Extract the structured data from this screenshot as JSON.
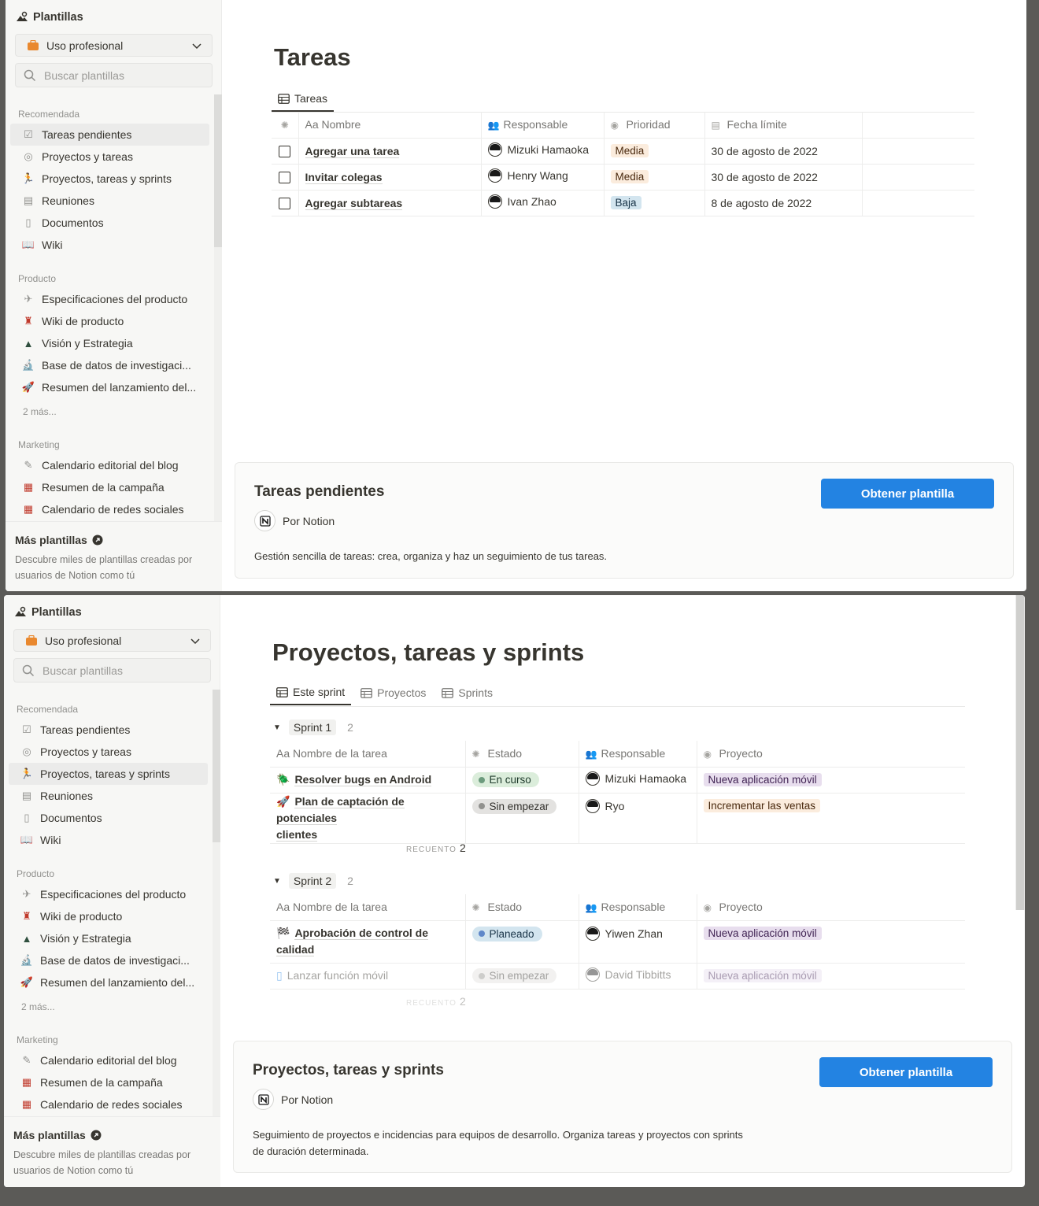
{
  "sidebar": {
    "header": "Plantillas",
    "use_select": "Uso profesional",
    "search_placeholder": "Buscar plantillas",
    "section_recommended": "Recomendada",
    "recommended": [
      "Tareas pendientes",
      "Proyectos y tareas",
      "Proyectos, tareas y sprints",
      "Reuniones",
      "Documentos",
      "Wiki"
    ],
    "section_product": "Producto",
    "product": [
      "Especificaciones del producto",
      "Wiki de producto",
      "Visión y Estrategia",
      "Base de datos de investigaci...",
      "Resumen del lanzamiento del..."
    ],
    "more": "2 más...",
    "section_marketing": "Marketing",
    "marketing": [
      "Calendario editorial del blog",
      "Resumen de la campaña",
      "Calendario de redes sociales"
    ],
    "footer_title": "Más plantillas",
    "footer_desc": "Descubre miles de plantillas creadas por usuarios de Notion como tú"
  },
  "panel1": {
    "title": "Tareas",
    "tab": "Tareas",
    "columns": [
      "Aa Nombre",
      "Responsable",
      "Prioridad",
      "Fecha límite"
    ],
    "rows": [
      {
        "name": "Agregar una tarea",
        "person": "Mizuki Hamaoka",
        "priority": "Media",
        "date": "30 de agosto de 2022"
      },
      {
        "name": "Invitar colegas",
        "person": "Henry Wang",
        "priority": "Media",
        "date": "30 de agosto de 2022"
      },
      {
        "name": "Agregar subtareas",
        "person": "Ivan Zhao",
        "priority": "Baja",
        "date": "8 de agosto de 2022"
      }
    ],
    "card": {
      "title": "Tareas pendientes",
      "author": "Por Notion",
      "button": "Obtener plantilla",
      "desc": "Gestión sencilla de tareas: crea, organiza y haz un seguimiento de tus tareas."
    }
  },
  "panel2": {
    "title": "Proyectos, tareas y sprints",
    "tabs": [
      "Este sprint",
      "Proyectos",
      "Sprints"
    ],
    "columns": [
      "Aa Nombre de la tarea",
      "Estado",
      "Responsable",
      "Proyecto"
    ],
    "groups": [
      {
        "name": "Sprint 1",
        "count": "2",
        "rows": [
          {
            "name": "Resolver bugs en Android",
            "status": "En curso",
            "person": "Mizuki Hamaoka",
            "project": "Nueva aplicación móvil"
          },
          {
            "name_a": "Plan de captación de potenciales",
            "name_b": "clientes",
            "status": "Sin empezar",
            "person": "Ryo",
            "project": "Incrementar las ventas"
          }
        ],
        "recuento_label": "RECUENTO",
        "recuento_value": "2"
      },
      {
        "name": "Sprint 2",
        "count": "2",
        "rows": [
          {
            "name_a": "Aprobación de control de",
            "name_b": "calidad",
            "status": "Planeado",
            "person": "Yiwen Zhan",
            "project": "Nueva aplicación móvil"
          },
          {
            "name": "Lanzar función móvil",
            "status": "Sin empezar",
            "person": "David Tibbitts",
            "project": "Nueva aplicación móvil"
          }
        ],
        "recuento_label": "RECUENTO",
        "recuento_value": "2"
      }
    ],
    "card": {
      "title": "Proyectos, tareas y sprints",
      "author": "Por Notion",
      "button": "Obtener plantilla",
      "desc_a": "Seguimiento de proyectos e incidencias para equipos de desarrollo. Organiza tareas y proyectos con sprints",
      "desc_b": "de duración determinada."
    }
  },
  "colors": {
    "accent": "#2383e2",
    "sidebar_bg": "#f7f7f5",
    "tag_media": "#fbecdd",
    "tag_baja": "#d3e5ef"
  }
}
